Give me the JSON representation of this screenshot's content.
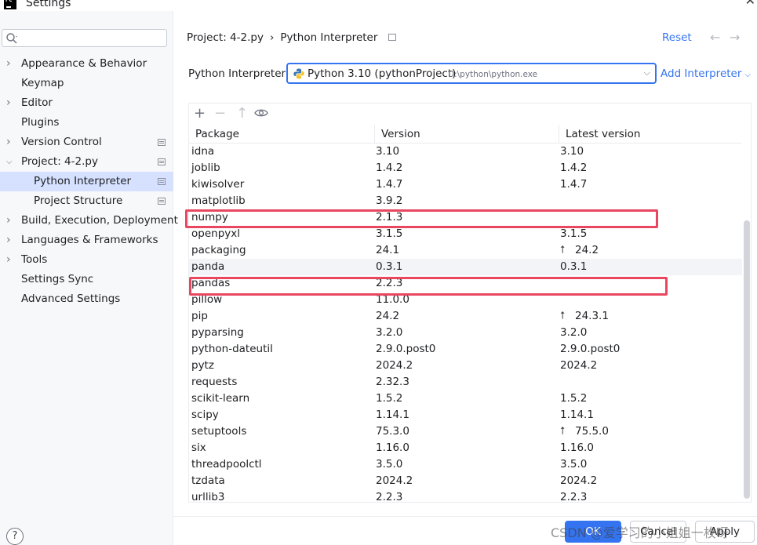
{
  "window": {
    "title": "Settings",
    "logo_text": "PC"
  },
  "search": {
    "placeholder": "Q",
    "value": ""
  },
  "sidebar": {
    "items": [
      {
        "label": "Appearance & Behavior",
        "expandable": true,
        "expanded": false
      },
      {
        "label": "Keymap",
        "expandable": false
      },
      {
        "label": "Editor",
        "expandable": true,
        "expanded": false
      },
      {
        "label": "Plugins",
        "expandable": false
      },
      {
        "label": "Version Control",
        "expandable": true,
        "expanded": false
      },
      {
        "label": "Project: 4-2.py",
        "expandable": true,
        "expanded": true
      },
      {
        "label": "Python Interpreter",
        "sub": true,
        "selected": true
      },
      {
        "label": "Project Structure",
        "sub": true
      },
      {
        "label": "Build, Execution, Deployment",
        "expandable": true,
        "expanded": false
      },
      {
        "label": "Languages & Frameworks",
        "expandable": true,
        "expanded": false
      },
      {
        "label": "Tools",
        "expandable": true,
        "expanded": false
      },
      {
        "label": "Settings Sync",
        "expandable": false
      },
      {
        "label": "Advanced Settings",
        "expandable": false
      }
    ]
  },
  "breadcrumb": {
    "project": "Project: 4-2.py",
    "separator": "›",
    "page": "Python Interpreter"
  },
  "header": {
    "reset_label": "Reset",
    "back": "←",
    "forward": "→"
  },
  "interpreter": {
    "label": "Python Interpreter:",
    "selected": "Python 3.10 (pythonProject)",
    "path": "D:\\python\\python.exe",
    "add_label": "Add Interpreter"
  },
  "toolbar": {
    "add": "+",
    "remove": "−",
    "upgrade": "↑"
  },
  "table": {
    "columns": [
      "Package",
      "Version",
      "Latest version"
    ],
    "rows": [
      {
        "package": "idna",
        "version": "3.10",
        "latest": "3.10",
        "upgrade": false
      },
      {
        "package": "joblib",
        "version": "1.4.2",
        "latest": "1.4.2",
        "upgrade": false
      },
      {
        "package": "kiwisolver",
        "version": "1.4.7",
        "latest": "1.4.7",
        "upgrade": false
      },
      {
        "package": "matplotlib",
        "version": "3.9.2",
        "latest": "",
        "upgrade": false
      },
      {
        "package": "numpy",
        "version": "2.1.3",
        "latest": "",
        "upgrade": false
      },
      {
        "package": "openpyxl",
        "version": "3.1.5",
        "latest": "3.1.5",
        "upgrade": false
      },
      {
        "package": "packaging",
        "version": "24.1",
        "latest": "24.2",
        "upgrade": true
      },
      {
        "package": "panda",
        "version": "0.3.1",
        "latest": "0.3.1",
        "upgrade": false
      },
      {
        "package": "pandas",
        "version": "2.2.3",
        "latest": "",
        "upgrade": false
      },
      {
        "package": "pillow",
        "version": "11.0.0",
        "latest": "",
        "upgrade": false
      },
      {
        "package": "pip",
        "version": "24.2",
        "latest": "24.3.1",
        "upgrade": true
      },
      {
        "package": "pyparsing",
        "version": "3.2.0",
        "latest": "3.2.0",
        "upgrade": false
      },
      {
        "package": "python-dateutil",
        "version": "2.9.0.post0",
        "latest": "2.9.0.post0",
        "upgrade": false
      },
      {
        "package": "pytz",
        "version": "2024.2",
        "latest": "2024.2",
        "upgrade": false
      },
      {
        "package": "requests",
        "version": "2.32.3",
        "latest": "",
        "upgrade": false
      },
      {
        "package": "scikit-learn",
        "version": "1.5.2",
        "latest": "1.5.2",
        "upgrade": false
      },
      {
        "package": "scipy",
        "version": "1.14.1",
        "latest": "1.14.1",
        "upgrade": false
      },
      {
        "package": "setuptools",
        "version": "75.3.0",
        "latest": "75.5.0",
        "upgrade": true
      },
      {
        "package": "six",
        "version": "1.16.0",
        "latest": "1.16.0",
        "upgrade": false
      },
      {
        "package": "threadpoolctl",
        "version": "3.5.0",
        "latest": "3.5.0",
        "upgrade": false
      },
      {
        "package": "tzdata",
        "version": "2024.2",
        "latest": "2024.2",
        "upgrade": false
      },
      {
        "package": "urllib3",
        "version": "2.2.3",
        "latest": "2.2.3",
        "upgrade": false
      }
    ]
  },
  "footer": {
    "ok_label": "OK",
    "cancel_label": "Cancel",
    "apply_label": "Apply",
    "help": "?"
  },
  "watermark": "CSDN @爱学习的小姐姐一枚呀",
  "colors": {
    "accent": "#3574f0",
    "highlight": "#e8475f",
    "selection": "#d5e1ff"
  }
}
